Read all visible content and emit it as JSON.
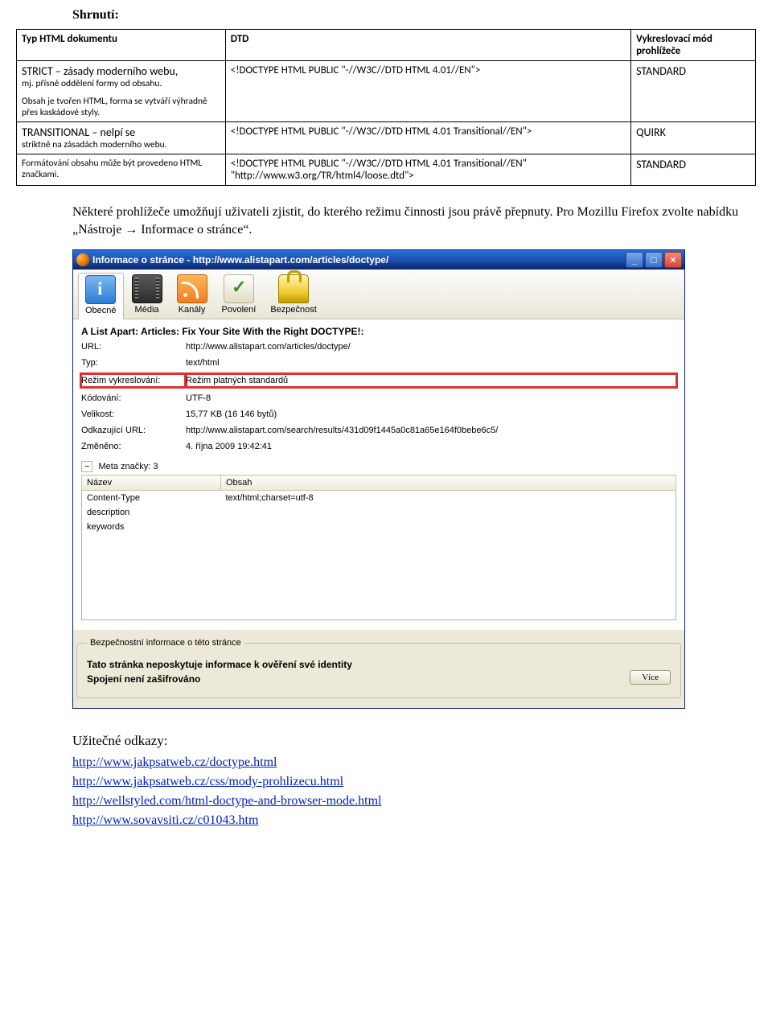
{
  "summary": {
    "title": "Shrnutí:",
    "headers": [
      "Typ HTML dokumentu",
      "DTD",
      "Vykreslovací mód prohlížeče"
    ],
    "rows": [
      {
        "type_main": "STRICT – zásady moderního webu,",
        "type_sub1": "mj. přísné oddělení formy od obsahu.",
        "type_sub2": "Obsah je tvořen HTML, forma se vytváří výhradně přes kaskádové styly.",
        "dtd": "<!DOCTYPE HTML PUBLIC \"-//W3C//DTD HTML 4.01//EN\">",
        "mode": "STANDARD"
      },
      {
        "type_main": "TRANSITIONAL – nelpí se",
        "type_sub1": "striktně na zásadách moderního webu.",
        "type_sub2": "",
        "dtd": "<!DOCTYPE HTML PUBLIC \"-//W3C//DTD HTML 4.01 Transitional//EN\">",
        "mode": "QUIRK"
      },
      {
        "type_main": "",
        "type_sub1": "Formátování obsahu může být provedeno HTML značkami.",
        "type_sub2": "",
        "dtd": "<!DOCTYPE HTML PUBLIC \"-//W3C//DTD HTML 4.01 Transitional//EN\" \"http://www.w3.org/TR/html4/loose.dtd\">",
        "mode": "STANDARD"
      }
    ]
  },
  "para1": "Některé prohlížeče umožňují uživateli zjistit, do kterého režimu činnosti jsou právě přepnuty. Pro Mozillu Firefox zvolte nabídku „Nástroje → Informace o stránce“.",
  "dialog": {
    "title": "Informace o stránce - http://www.alistapart.com/articles/doctype/",
    "tabs": {
      "general": "Obecné",
      "media": "Média",
      "feeds": "Kanály",
      "perm": "Povolení",
      "sec": "Bezpečnost"
    },
    "heading": "A List Apart: Articles: Fix Your Site With the Right DOCTYPE!:",
    "rows": {
      "url_l": "URL:",
      "url_v": "http://www.alistapart.com/articles/doctype/",
      "type_l": "Typ:",
      "type_v": "text/html",
      "render_l": "Režim vykreslování:",
      "render_v": "Režim platných standardů",
      "enc_l": "Kódování:",
      "enc_v": "UTF-8",
      "size_l": "Velikost:",
      "size_v": "15,77 KB (16 146 bytů)",
      "ref_l": "Odkazující URL:",
      "ref_v": "http://www.alistapart.com/search/results/431d09f1445a0c81a65e164f0bebe6c5/",
      "mod_l": "Změněno:",
      "mod_v": "4. října 2009 19:42:41"
    },
    "meta": {
      "toggle": "−",
      "label": "Meta značky: 3",
      "h_name": "Název",
      "h_content": "Obsah",
      "r1_name": "Content-Type",
      "r1_content": "text/html;charset=utf-8",
      "r2_name": "description",
      "r2_content": "",
      "r3_name": "keywords",
      "r3_content": ""
    },
    "security": {
      "legend": "Bezpečnostní informace o této stránce",
      "line1": "Tato stránka neposkytuje informace k ověření své identity",
      "line2": "Spojení není zašifrováno",
      "more": "Více"
    }
  },
  "links": {
    "title": "Užitečné odkazy:",
    "l1": "http://www.jakpsatweb.cz/doctype.html",
    "l2": "http://www.jakpsatweb.cz/css/mody-prohlizecu.html",
    "l3": "http://wellstyled.com/html-doctype-and-browser-mode.html",
    "l4": "http://www.sovavsiti.cz/c01043.htm"
  }
}
